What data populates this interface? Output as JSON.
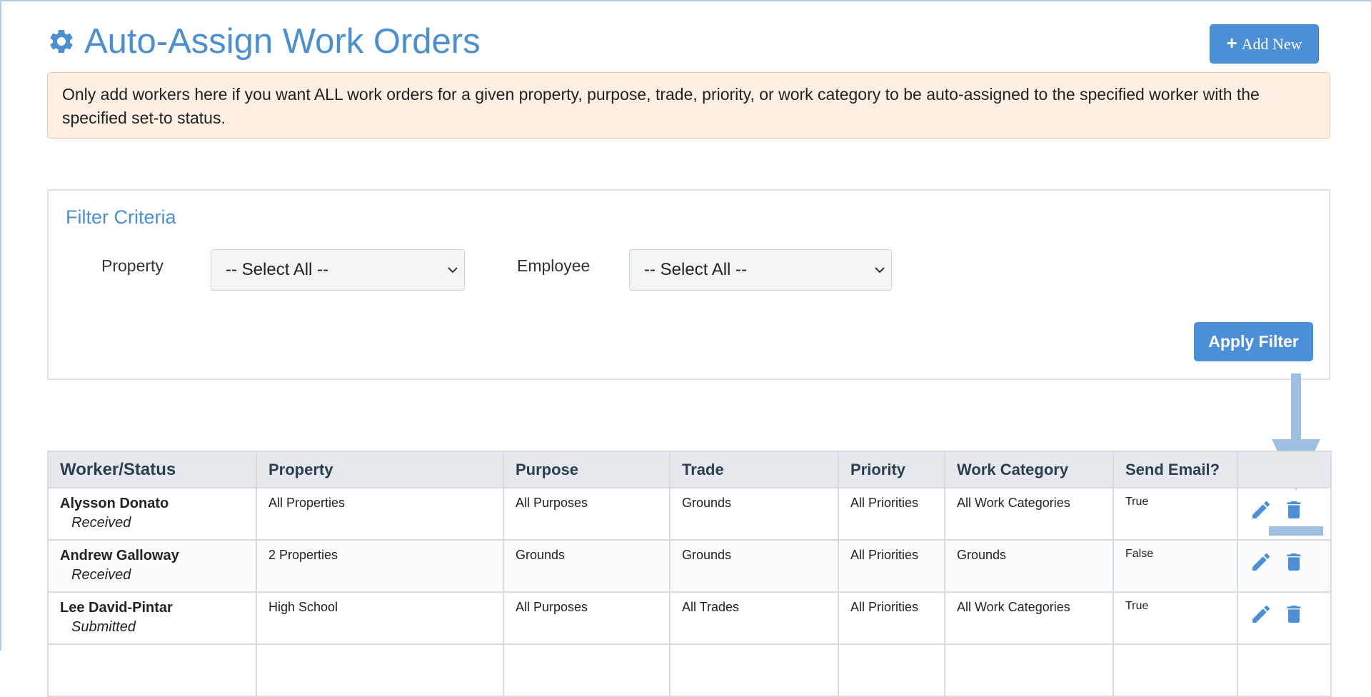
{
  "header": {
    "title": "Auto-Assign Work Orders",
    "add_new_label": "Add New"
  },
  "alert": {
    "text": "Only add workers here if you want ALL work orders for a given property, purpose, trade, priority, or work category to be auto-assigned to the specified worker with the specified set-to status."
  },
  "filter": {
    "title": "Filter Criteria",
    "property_label": "Property",
    "property_value": "-- Select All --",
    "employee_label": "Employee",
    "employee_value": "-- Select All --",
    "apply_label": "Apply Filter"
  },
  "table": {
    "columns": [
      "Worker/Status",
      "Property",
      "Purpose",
      "Trade",
      "Priority",
      "Work Category",
      "Send Email?",
      ""
    ],
    "rows": [
      {
        "worker": "Alysson Donato",
        "status": "Received",
        "property": "All Properties",
        "purpose": "All Purposes",
        "trade": "Grounds",
        "priority": "All Priorities",
        "work_category": "All Work Categories",
        "send_email": "True"
      },
      {
        "worker": "Andrew Galloway",
        "status": "Received",
        "property": "2 Properties",
        "purpose": "Grounds",
        "trade": "Grounds",
        "priority": "All Priorities",
        "work_category": "Grounds",
        "send_email": "False"
      },
      {
        "worker": "Lee David-Pintar",
        "status": "Submitted",
        "property": "High School",
        "purpose": "All Purposes",
        "trade": "All Trades",
        "priority": "All Priorities",
        "work_category": "All Work Categories",
        "send_email": "True"
      }
    ]
  },
  "colors": {
    "primary": "#4a8fd8",
    "title": "#4a8fd1",
    "alert_bg": "#fdefe3",
    "annotation": "#9ebfe0"
  },
  "icons": {
    "title": "gear-icon",
    "add": "plus-icon",
    "edit": "pencil-icon",
    "delete": "trash-icon",
    "select": "chevron-down-icon"
  }
}
